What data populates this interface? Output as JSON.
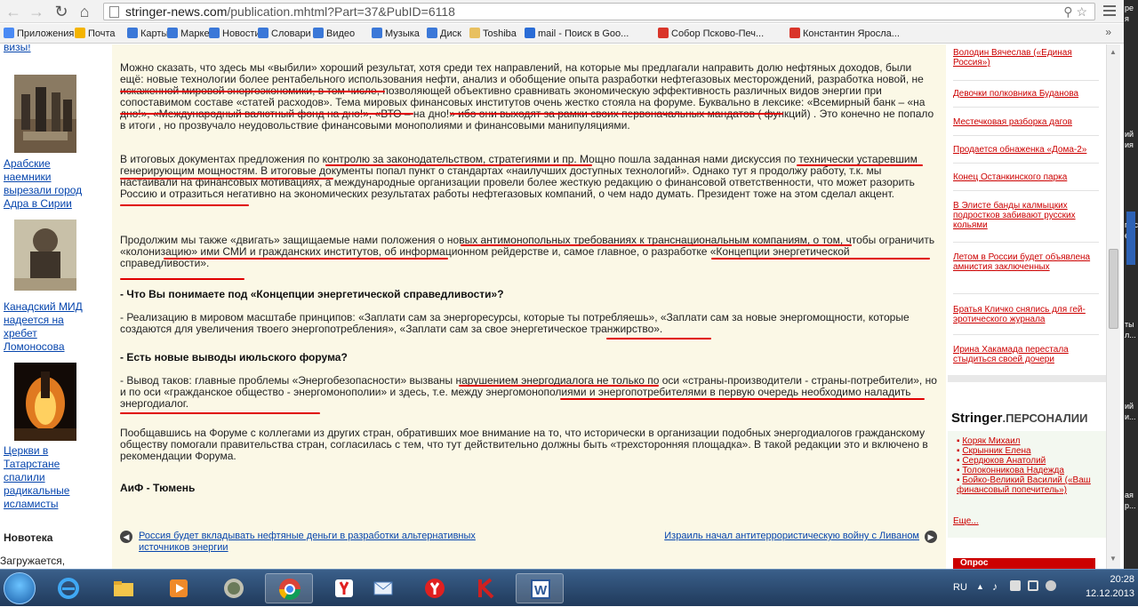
{
  "browser": {
    "url_host": "stringer-news.com",
    "url_path": "/publication.mhtml?Part=37&PubID=6118"
  },
  "bookmarks": [
    {
      "label": "Приложения",
      "color": "#4a8af4"
    },
    {
      "label": "Почта",
      "color": "#f4b400"
    },
    {
      "label": "Карты",
      "color": "#3b78d8"
    },
    {
      "label": "Маркет",
      "color": "#3b78d8"
    },
    {
      "label": "Новости",
      "color": "#3b78d8"
    },
    {
      "label": "Словари",
      "color": "#3b78d8"
    },
    {
      "label": "Видео",
      "color": "#3b78d8"
    },
    {
      "label": "Музыка",
      "color": "#3b78d8"
    },
    {
      "label": "Диск",
      "color": "#3b78d8"
    },
    {
      "label": "Toshiba",
      "color": "#e8c060"
    },
    {
      "label": "mail - Поиск в Goo...",
      "color": "#2a6cd6"
    },
    {
      "label": "Собор Псково-Печ...",
      "color": "#d9352a"
    },
    {
      "label": "Константин Яросла...",
      "color": "#d9352a"
    }
  ],
  "bookmarks_more": "»",
  "left_column": {
    "top_link": "визы!",
    "links": [
      "Арабские наемники вырезали город Адра в Сирии",
      "Канадский МИД надеется на хребет Ломоносова",
      "Церкви в Татарстане спалили радикальные исламисты"
    ],
    "novotka_title": "Новотека",
    "loading": "Загружается,"
  },
  "article": {
    "p1": "Можно сказать, что здесь мы «выбили» хороший результат, хотя среди тех направлений, на которые мы предлагали направить долю нефтяных доходов, были ещё: новые технологии более рентабельного использования нефти, анализ и обобщение опыта разработки нефтегазовых месторождений, разработка новой, не искаженной мировой энергоэкономики, в том числе, позволяющей объективно сравнивать экономическую эффективность различных видов энергии при сопоставимом составе «статей расходов». Тема мировых финансовых институтов очень жестко стояла на форуме. Буквально в лексике: «Всемирный банк – «на дно!», «Международный валютный фонд на дно!», «ВТО – на дно!» ибо они выходят за рамки своих первоначальных мандатов ( функций) . Это конечно не попало в итоги , но прозвучало неудовольствие финансовыми монополиями и финансовыми манипуляциями.",
    "p2": "В итоговых документах предложения по контролю за законодательством, стратегиями и пр. Мощно пошла заданная нами дискуссия по технически устаревшим генерирующим мощностям. В итоговые документы попал пункт о стандартах «наилучших доступных технологий». Однако тут я продолжу работу, т.к. мы настаивали на финансовых мотивациях, а международные организации провели более жесткую редакцию о финансовой ответственности, что может разорить Россию и отразиться негативно на экономических результатах работы нефтегазовых компаний, о чем надо думать. Президент тоже на этом сделал акцент.",
    "p3": "Продолжим мы также «двигать» защищаемые нами положения о новых антимонопольных требованиях к транснациональным компаниям, о том, чтобы ограничить «колонизацию» ими СМИ и гражданских институтов, об информационном рейдерстве и, самое главное, о разработке «Концепции энергетической справедливости».",
    "q1": "- Что Вы понимаете под «Концепции энергетической справедливости»?",
    "a1": "- Реализацию в мировом масштабе принципов: «Заплати сам за энергоресурсы, которые ты потребляешь», «Заплати сам за новые энергомощности, которые создаются для увеличения твоего энергопотребления», «Заплати сам за свое энергетическое транжирство».",
    "q2": "- Есть новые выводы июльского форума?",
    "a2": "- Вывод таков: главные проблемы «Энергобезопасности» вызваны нарушением энергодиалога не только по оси «страны-производители - страны-потребители», но и по оси «гражданское общество - энергомонополии» и здесь, т.е. между энергомонополиями и энергопотребителями в первую очередь необходимо наладить энергодиалог.",
    "p4": "Пообщавшись на Форуме с коллегами из других стран, обративших мое внимание на то, что исторически в организации подобных энергодиалогов гражданскому обществу помогали правительства стран, согласилась с тем, что тут действительно должны быть «трехсторонняя площадка». В такой редакции это и включено в рекомендации Форума.",
    "source": "АиФ - Тюмень",
    "prev_link": "Россия будет вкладывать нефтяные деньги в разработки альтернативных источников энергии",
    "next_link": "Израиль начал антитеррористическую войну с Ливаном"
  },
  "right_column": {
    "news": [
      "Володин Вячеслав («Единая Россия»)",
      "Девочки полковника Буданова",
      "Местечковая разборка дагов",
      "Продается обнаженка «Дома-2»",
      "Конец Останкинского парка",
      "В Элисте банды калмыцких подростков забивают русских кольями",
      "Летом в России будет объявлена амнистия заключенных",
      "Братья Кличко снялись для гей-эротического журнала",
      "Ирина Хакамада перестала стыдиться своей дочери"
    ],
    "brand": "Stringer",
    "brand_suffix": ".ПЕРСОНАЛИИ",
    "personalities": [
      "Коряк Михаил",
      "Скрынник Елена",
      "Сердюков Анатолий",
      "Толоконникова Надежда",
      "Бойко-Великий Василий («Ваш финансовый попечитель»)"
    ],
    "more": "Еще...",
    "opros": "Опрос"
  },
  "outer_fragments": [
    "ре",
    "я",
    "ий",
    "ия",
    "ге с",
    "е...",
    "ты",
    "л...",
    "ий",
    "и...",
    "ая",
    "р..."
  ],
  "taskbar": {
    "lang": "RU",
    "time": "20:28",
    "date": "12.12.2013"
  },
  "colors": {
    "article_bg": "#fbf8e6",
    "underline": "#e00000",
    "link_blue": "#0645ad",
    "link_red": "#cc0000"
  }
}
